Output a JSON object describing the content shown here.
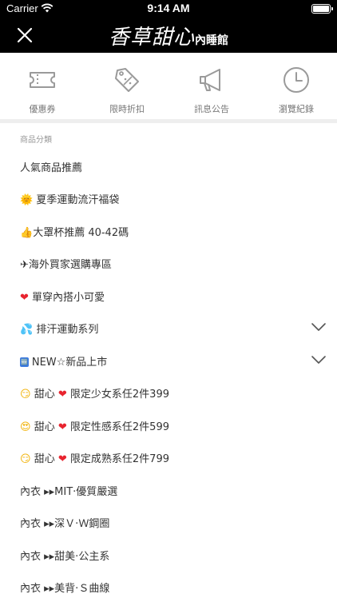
{
  "status_bar": {
    "carrier": "Carrier",
    "time": "9:14 AM"
  },
  "header": {
    "logo_main": "香草甜心",
    "logo_sub": "內睡館"
  },
  "quicklinks": [
    {
      "label": "優惠券",
      "icon": "ticket-icon"
    },
    {
      "label": "限時折扣",
      "icon": "discount-tag-icon"
    },
    {
      "label": "訊息公告",
      "icon": "megaphone-icon"
    },
    {
      "label": "瀏覽紀錄",
      "icon": "clock-icon"
    }
  ],
  "section_title": "商品分類",
  "categories": [
    {
      "label": "人氣商品推薦"
    },
    {
      "emoji": "🌞",
      "label": "夏季運動流汗福袋"
    },
    {
      "emoji": "👍",
      "label": "大罩杯推薦 40-42碼"
    },
    {
      "emoji": "✈",
      "label": "海外買家選購專區"
    },
    {
      "emoji": "❤",
      "label": "單穿內搭小可愛"
    },
    {
      "emoji": "💦",
      "label": "排汗運動系列",
      "expandable": true
    },
    {
      "emoji": "🆕",
      "label": "NEW☆新品上市",
      "expandable": true
    },
    {
      "emoji": "😏",
      "label": "甜心",
      "emoji2": "❤",
      "label2": "限定少女系任2件399"
    },
    {
      "emoji": "😍",
      "label": "甜心",
      "emoji2": "❤",
      "label2": "限定性感系任2件599"
    },
    {
      "emoji": "😏",
      "label": "甜心",
      "emoji2": "❤",
      "label2": "限定成熟系任2件799"
    },
    {
      "label": "內衣 ▸▸MIT‧優質嚴選"
    },
    {
      "label": "內衣 ▸▸深Ｖ‧Ｗ鋼圈"
    },
    {
      "label": "內衣 ▸▸甜美‧公主系"
    },
    {
      "label": "內衣 ▸▸美背‧Ｓ曲線"
    }
  ],
  "colors": {
    "header_bg": "#000000",
    "divider": "#eeeeee",
    "icon_gray": "#9a9a9a"
  }
}
